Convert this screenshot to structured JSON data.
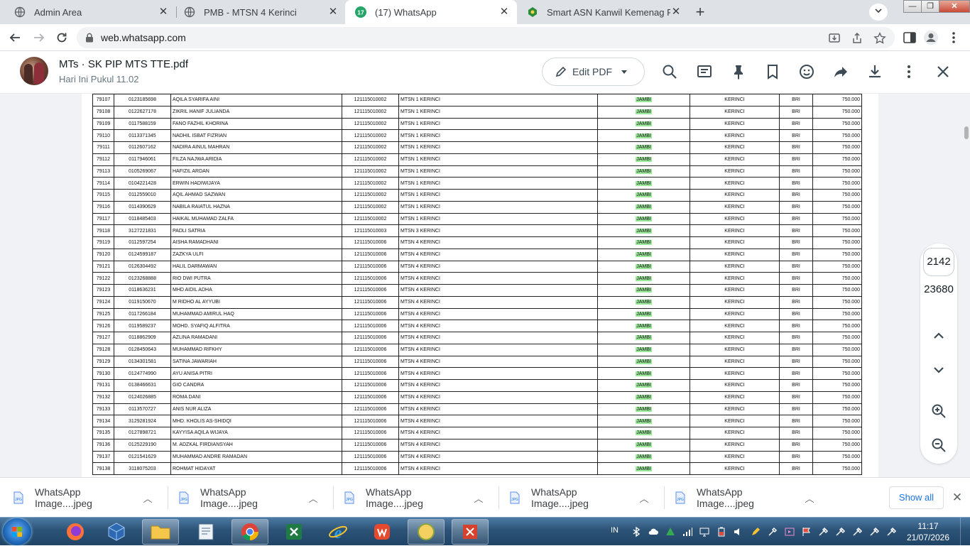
{
  "browser": {
    "tabs": [
      {
        "title": "Admin Area",
        "icon": "globe-icon",
        "active": false
      },
      {
        "title": "PMB - MTSN 4 Kerinci",
        "icon": "globe-icon",
        "active": false
      },
      {
        "title": "(17) WhatsApp",
        "icon": "whatsapp-icon",
        "badge": "17",
        "active": true
      },
      {
        "title": "Smart ASN Kanwil Kemenag Prov",
        "icon": "kemenag-icon",
        "active": false
      }
    ],
    "url": "web.whatsapp.com"
  },
  "viewer": {
    "title": "MTs · SK PIP MTS TTE.pdf",
    "subtitle": "Hari Ini Pukul 11.02",
    "edit_label": "Edit PDF",
    "page_current": "2142",
    "page_total": "23680"
  },
  "table": {
    "rows": [
      [
        "79107",
        "0123185698",
        "AQILA SYARIFA AINI",
        "121115010002",
        "MTSN 1 KERINCI",
        "JAMBI",
        "KERINCI",
        "BRI",
        "750.000"
      ],
      [
        "79108",
        "0122627178",
        "ZIKRIL HANIF JULIANDA",
        "121115010002",
        "MTSN 1 KERINCI",
        "JAMBI",
        "KERINCI",
        "BRI",
        "750.000"
      ],
      [
        "79109",
        "0117588159",
        "FANO FAZHIL KHORINA",
        "121115010002",
        "MTSN 1 KERINCI",
        "JAMBI",
        "KERINCI",
        "BRI",
        "750.000"
      ],
      [
        "79110",
        "0113371345",
        "NADHIL ISBAT FIZRIAN",
        "121115010002",
        "MTSN 1 KERINCI",
        "JAMBI",
        "KERINCI",
        "BRI",
        "750.000"
      ],
      [
        "79111",
        "0112607162",
        "NADIRA AINUL MAHRAN",
        "121115010002",
        "MTSN 1 KERINCI",
        "JAMBI",
        "KERINCI",
        "BRI",
        "750.000"
      ],
      [
        "79112",
        "0117946061",
        "FILZA NAJWA ARIDIA",
        "121115010002",
        "MTSN 1 KERINCI",
        "JAMBI",
        "KERINCI",
        "BRI",
        "750.000"
      ],
      [
        "79113",
        "0105269067",
        "HAFIZIL ARDAN",
        "121115010002",
        "MTSN 1 KERINCI",
        "JAMBI",
        "KERINCI",
        "BRI",
        "750.000"
      ],
      [
        "79114",
        "0104221428",
        "ERWIN HADIWIJAYA",
        "121115010002",
        "MTSN 1 KERINCI",
        "JAMBI",
        "KERINCI",
        "BRI",
        "750.000"
      ],
      [
        "79115",
        "0112559010",
        "AQIL AHMAD SAZWAN",
        "121115010002",
        "MTSN 1 KERINCI",
        "JAMBI",
        "KERINCI",
        "BRI",
        "750.000"
      ],
      [
        "79116",
        "0114390629",
        "NABILA RAIATUL HAZNA",
        "121115010002",
        "MTSN 1 KERINCI",
        "JAMBI",
        "KERINCI",
        "BRI",
        "750.000"
      ],
      [
        "79117",
        "0118485403",
        "HAIKAL MUHAMAD ZALFA",
        "121115010002",
        "MTSN 1 KERINCI",
        "JAMBI",
        "KERINCI",
        "BRI",
        "750.000"
      ],
      [
        "79118",
        "3127221831",
        "PADLI SATRIA",
        "121115010003",
        "MTSN 3 KERINCI",
        "JAMBI",
        "KERINCI",
        "BRI",
        "750.000"
      ],
      [
        "79119",
        "0112597254",
        "AISHA RAMADHANI",
        "121115010006",
        "MTSN 4 KERINCI",
        "JAMBI",
        "KERINCI",
        "BRI",
        "750.000"
      ],
      [
        "79120",
        "0124599187",
        "ZAZKYA ULFI",
        "121115010006",
        "MTSN 4 KERINCI",
        "JAMBI",
        "KERINCI",
        "BRI",
        "750.000"
      ],
      [
        "79121",
        "0126304492",
        "HALIL DARMAWAN",
        "121115010006",
        "MTSN 4 KERINCI",
        "JAMBI",
        "KERINCI",
        "BRI",
        "750.000"
      ],
      [
        "79122",
        "0123268888",
        "RIO DWI PUTRA",
        "121115010006",
        "MTSN 4 KERINCI",
        "JAMBI",
        "KERINCI",
        "BRI",
        "750.000"
      ],
      [
        "79123",
        "0118636231",
        "MHD AIDIL ADHA",
        "121115010006",
        "MTSN 4 KERINCI",
        "JAMBI",
        "KERINCI",
        "BRI",
        "750.000"
      ],
      [
        "79124",
        "0119150670",
        "M RIDHO AL AYYUBI",
        "121115010006",
        "MTSN 4 KERINCI",
        "JAMBI",
        "KERINCI",
        "BRI",
        "750.000"
      ],
      [
        "79125",
        "0117266184",
        "MUHAMMAD AMIRUL HAQ",
        "121115010006",
        "MTSN 4 KERINCI",
        "JAMBI",
        "KERINCI",
        "BRI",
        "750.000"
      ],
      [
        "79126",
        "0119589237",
        "MOHD. SYAFIQ ALFITRA",
        "121115010006",
        "MTSN 4 KERINCI",
        "JAMBI",
        "KERINCI",
        "BRI",
        "750.000"
      ],
      [
        "79127",
        "0118862909",
        "AZLINA RAMADANI",
        "121115010006",
        "MTSN 4 KERINCI",
        "JAMBI",
        "KERINCI",
        "BRI",
        "750.000"
      ],
      [
        "79128",
        "0128450643",
        "MUHAMMAD RIFKHY",
        "121115010006",
        "MTSN 4 KERINCI",
        "JAMBI",
        "KERINCI",
        "BRI",
        "750.000"
      ],
      [
        "79129",
        "0134301581",
        "SATINA JAWARIAH",
        "121115010006",
        "MTSN 4 KERINCI",
        "JAMBI",
        "KERINCI",
        "BRI",
        "750.000"
      ],
      [
        "79130",
        "0124774990",
        "AYU ANISA PITRI",
        "121115010006",
        "MTSN 4 KERINCI",
        "JAMBI",
        "KERINCI",
        "BRI",
        "750.000"
      ],
      [
        "79131",
        "0138466631",
        "GIO CANDRA",
        "121115010006",
        "MTSN 4 KERINCI",
        "JAMBI",
        "KERINCI",
        "BRI",
        "750.000"
      ],
      [
        "79132",
        "0124026885",
        "ROMA DANI",
        "121115010006",
        "MTSN 4 KERINCI",
        "JAMBI",
        "KERINCI",
        "BRI",
        "750.000"
      ],
      [
        "79133",
        "0113570727",
        "ANIS NUR ALIZA",
        "121115010006",
        "MTSN 4 KERINCI",
        "JAMBI",
        "KERINCI",
        "BRI",
        "750.000"
      ],
      [
        "79134",
        "3129281924",
        "MHD. KHOLIS AS-SHIDQI",
        "121115010006",
        "MTSN 4 KERINCI",
        "JAMBI",
        "KERINCI",
        "BRI",
        "750.000"
      ],
      [
        "79135",
        "0127898721",
        "KAYYISA AQILA WIJAYA",
        "121115010006",
        "MTSN 4 KERINCI",
        "JAMBI",
        "KERINCI",
        "BRI",
        "750.000"
      ],
      [
        "79136",
        "0125229190",
        "M. ADZKAL FIRDIANSYAH",
        "121115010006",
        "MTSN 4 KERINCI",
        "JAMBI",
        "KERINCI",
        "BRI",
        "750.000"
      ],
      [
        "79137",
        "0121541629",
        "MUHAMMAD ANDRE RAMADAN",
        "121115010006",
        "MTSN 4 KERINCI",
        "JAMBI",
        "KERINCI",
        "BRI",
        "750.000"
      ],
      [
        "79138",
        "3118075203",
        "ROHMAT HIDAYAT",
        "121115010006",
        "MTSN 4 KERINCI",
        "JAMBI",
        "KERINCI",
        "BRI",
        "750.000"
      ]
    ],
    "highlight_color": "#9be89b"
  },
  "downloads": {
    "items": [
      "WhatsApp Image....jpeg",
      "WhatsApp Image....jpeg",
      "WhatsApp Image....jpeg",
      "WhatsApp Image....jpeg",
      "WhatsApp Image....jpeg"
    ],
    "show_all_label": "Show all"
  },
  "taskbar": {
    "lang": "IN",
    "time": "11:17",
    "date": "21/07/2026"
  }
}
